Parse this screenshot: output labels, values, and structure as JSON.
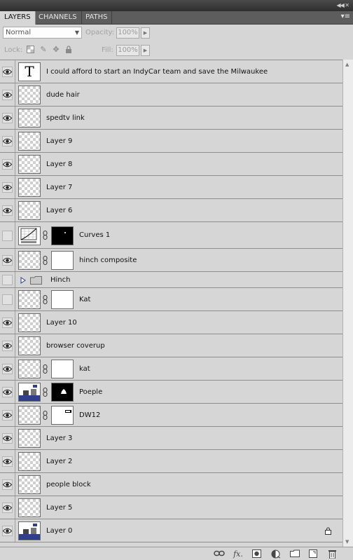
{
  "panel": {
    "tabs": [
      {
        "label": "LAYERS",
        "active": true
      },
      {
        "label": "CHANNELS",
        "active": false
      },
      {
        "label": "PATHS",
        "active": false
      }
    ]
  },
  "options": {
    "blend_mode": "Normal",
    "opacity_label": "Opacity:",
    "opacity_value": "100%",
    "lock_label": "Lock:",
    "fill_label": "Fill:",
    "fill_value": "100%"
  },
  "layers": [
    {
      "name": "I could afford to start an IndyCar team and save the Milwaukee",
      "visible": true,
      "thumb": "text"
    },
    {
      "name": "dude hair",
      "visible": true,
      "thumb": "transparent"
    },
    {
      "name": "spedtv link",
      "visible": true,
      "thumb": "transparent"
    },
    {
      "name": "Layer 9",
      "visible": true,
      "thumb": "transparent"
    },
    {
      "name": "Layer 8",
      "visible": true,
      "thumb": "transparent"
    },
    {
      "name": "Layer 7",
      "visible": true,
      "thumb": "transparent"
    },
    {
      "name": "Layer 6",
      "visible": true,
      "thumb": "transparent"
    },
    {
      "name": "Curves 1",
      "visible": false,
      "thumb": "curves",
      "mask": "black-dot"
    },
    {
      "name": "hinch composite",
      "visible": true,
      "thumb": "transparent",
      "mask": "white"
    },
    {
      "name": "Hinch",
      "visible": false,
      "thumb": "group"
    },
    {
      "name": "Kat",
      "visible": false,
      "thumb": "transparent",
      "mask": "white"
    },
    {
      "name": "Layer 10",
      "visible": true,
      "thumb": "transparent"
    },
    {
      "name": "browser coverup",
      "visible": true,
      "thumb": "transparent"
    },
    {
      "name": "kat",
      "visible": true,
      "thumb": "transparent",
      "mask": "white"
    },
    {
      "name": "Poeple",
      "visible": true,
      "thumb": "photo",
      "mask": "black-shape"
    },
    {
      "name": "DW12",
      "visible": true,
      "thumb": "transparent",
      "mask": "white-shape"
    },
    {
      "name": "Layer 3",
      "visible": true,
      "thumb": "transparent"
    },
    {
      "name": "Layer 2",
      "visible": true,
      "thumb": "transparent"
    },
    {
      "name": "people block",
      "visible": true,
      "thumb": "transparent"
    },
    {
      "name": "Layer 5",
      "visible": true,
      "thumb": "transparent"
    },
    {
      "name": "Layer 0",
      "visible": true,
      "thumb": "photo",
      "locked": true
    }
  ],
  "bottom_bar": {
    "icons": [
      "link-layers-icon",
      "fx-icon",
      "add-mask-icon",
      "adjustment-layer-icon",
      "new-group-icon",
      "new-layer-icon",
      "trash-icon"
    ],
    "fx_label": "fx."
  }
}
